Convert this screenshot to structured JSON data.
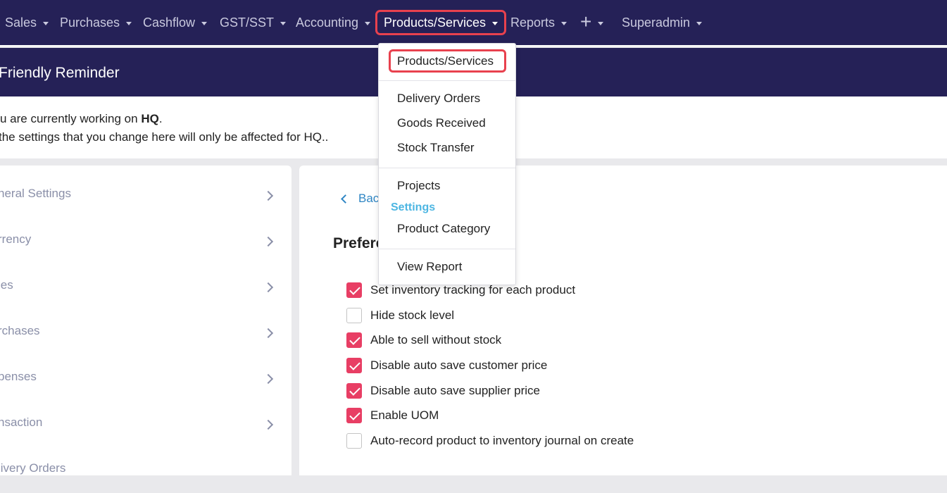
{
  "nav": {
    "items": [
      {
        "label": "Sales"
      },
      {
        "label": "Purchases"
      },
      {
        "label": "Cashflow"
      },
      {
        "label": "GST/SST"
      },
      {
        "label": "Accounting"
      },
      {
        "label": "Products/Services"
      },
      {
        "label": "Reports"
      },
      {
        "label": "+"
      },
      {
        "label": "Superadmin"
      }
    ]
  },
  "banner": {
    "title": "Friendly Reminder"
  },
  "notice": {
    "line1_prefix": "u are currently working on ",
    "line1_bold": "HQ",
    "line1_suffix": ".",
    "line2": " the settings that you change here will only be affected for HQ.."
  },
  "sidebar": {
    "items": [
      {
        "label": "neral Settings"
      },
      {
        "label": "rrency"
      },
      {
        "label": "les"
      },
      {
        "label": "rchases"
      },
      {
        "label": "penses"
      },
      {
        "label": "nsaction"
      },
      {
        "label": "livery Orders"
      }
    ]
  },
  "main": {
    "back_label": "Bac",
    "title": "Prefere",
    "options": [
      {
        "label": "Set inventory tracking for each product",
        "checked": true
      },
      {
        "label": "Hide stock level",
        "checked": false
      },
      {
        "label": "Able to sell without stock",
        "checked": true
      },
      {
        "label": "Disable auto save customer price",
        "checked": true
      },
      {
        "label": "Disable auto save supplier price",
        "checked": true
      },
      {
        "label": "Enable UOM",
        "checked": true
      },
      {
        "label": "Auto-record product to inventory journal on create",
        "checked": false
      }
    ]
  },
  "dropdown": {
    "items": [
      {
        "label": "Products/Services"
      },
      {
        "label": "Delivery Orders"
      },
      {
        "label": "Goods Received"
      },
      {
        "label": "Stock Transfer"
      },
      {
        "label": "Projects"
      },
      {
        "label": "Product Category"
      },
      {
        "label": "View Report"
      }
    ],
    "settings_header": "Settings"
  },
  "colors": {
    "nav_bg": "#252157",
    "highlight": "#e8414e",
    "checkbox_checked": "#e83e64",
    "link": "#2f86c4",
    "settings_header": "#4db6e2"
  }
}
